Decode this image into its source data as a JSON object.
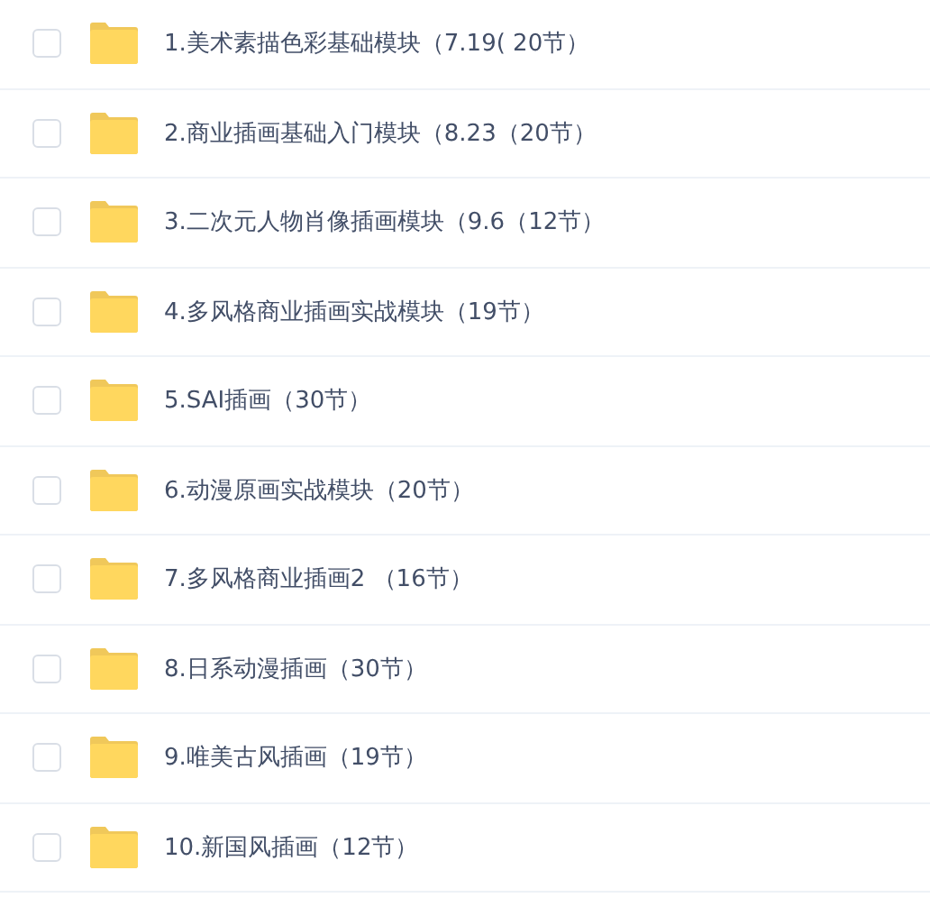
{
  "files": [
    {
      "name": "1.美术素描色彩基础模块（7.19( 20节）",
      "checked": false
    },
    {
      "name": "2.商业插画基础入门模块（8.23（20节）",
      "checked": false
    },
    {
      "name": "3.二次元人物肖像插画模块（9.6（12节）",
      "checked": false
    },
    {
      "name": "4.多风格商业插画实战模块（19节）",
      "checked": false
    },
    {
      "name": "5.SAI插画（30节）",
      "checked": false
    },
    {
      "name": "6.动漫原画实战模块（20节）",
      "checked": false
    },
    {
      "name": "7.多风格商业插画2 （16节）",
      "checked": false
    },
    {
      "name": "8.日系动漫插画（30节）",
      "checked": false
    },
    {
      "name": "9.唯美古风插画（19节）",
      "checked": false
    },
    {
      "name": "10.新国风插画（12节）",
      "checked": false
    }
  ]
}
